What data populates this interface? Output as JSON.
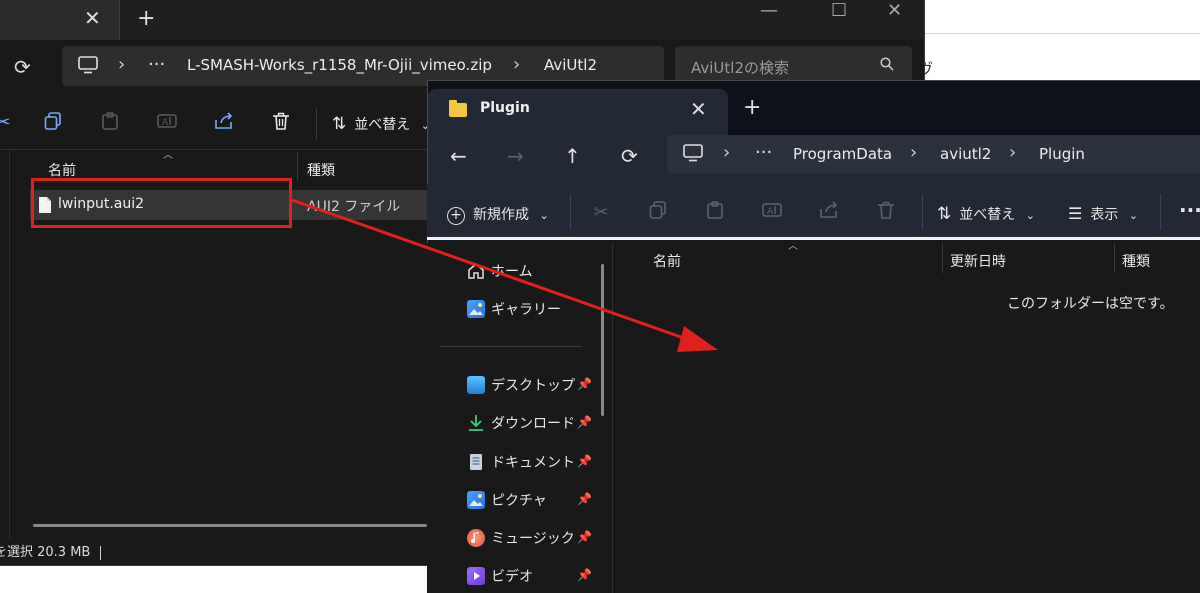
{
  "window_back": {
    "breadcrumb": [
      "L-SMASH-Works_r1158_Mr-Ojii_vimeo.zip",
      "AviUtl2"
    ],
    "more": "···",
    "search_placeholder": "AviUtl2の検索",
    "sort_label": "並べ替え",
    "columns": {
      "name": "名前",
      "type": "種類"
    },
    "file": {
      "name": "lwinput.aui2",
      "type": "AUI2 ファイル"
    },
    "status": "を選択  20.3 MB"
  },
  "window_front": {
    "tab_title": "Plugin",
    "breadcrumb": [
      "ProgramData",
      "aviutl2",
      "Plugin"
    ],
    "more": "···",
    "new_label": "新規作成",
    "sort_label": "並べ替え",
    "view_label": "表示",
    "columns": {
      "name": "名前",
      "modified": "更新日時",
      "type": "種類"
    },
    "empty_message": "このフォルダーは空です。",
    "nav": {
      "home": "ホーム",
      "gallery": "ギャラリー",
      "desktop": "デスクトップ",
      "downloads": "ダウンロード",
      "documents": "ドキュメント",
      "pictures": "ピクチャ",
      "music": "ミュージック",
      "videos": "ビデオ"
    }
  },
  "colors": {
    "highlight": "#e0201c",
    "accent_icon": "#7aa8ff",
    "folder": "#f6c744"
  }
}
